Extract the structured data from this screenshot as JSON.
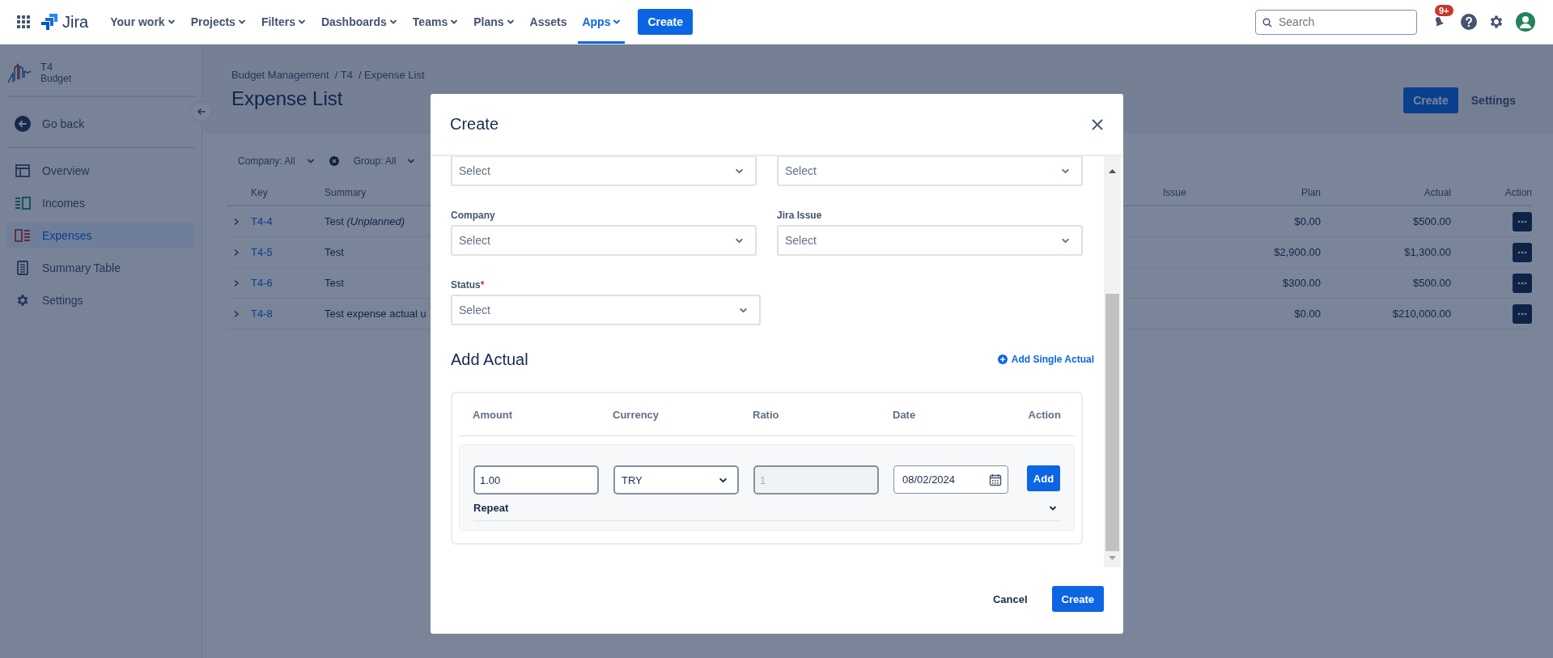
{
  "top_nav": {
    "product": "Jira",
    "items": [
      {
        "label": "Your work",
        "dropdown": true,
        "selected": false
      },
      {
        "label": "Projects",
        "dropdown": true,
        "selected": false
      },
      {
        "label": "Filters",
        "dropdown": true,
        "selected": false
      },
      {
        "label": "Dashboards",
        "dropdown": true,
        "selected": false
      },
      {
        "label": "Teams",
        "dropdown": true,
        "selected": false
      },
      {
        "label": "Plans",
        "dropdown": true,
        "selected": false
      },
      {
        "label": "Assets",
        "dropdown": false,
        "selected": false
      },
      {
        "label": "Apps",
        "dropdown": true,
        "selected": true
      }
    ],
    "create_button": "Create",
    "search": {
      "placeholder": "Search"
    },
    "notifications_badge": "9+"
  },
  "sidebar": {
    "project": {
      "name": "T4",
      "subtitle": "Budget"
    },
    "back": "Go back",
    "items": [
      {
        "label": "Overview",
        "selected": false
      },
      {
        "label": "Incomes",
        "selected": false
      },
      {
        "label": "Expenses",
        "selected": true
      },
      {
        "label": "Summary Table",
        "selected": false
      },
      {
        "label": "Settings",
        "selected": false
      }
    ]
  },
  "page": {
    "breadcrumbs": [
      "Budget Management",
      "/ T4",
      "/ Expense List"
    ],
    "title": "Expense List",
    "buttons": [
      {
        "label": "Create",
        "kind": "primary"
      },
      {
        "label": "Settings",
        "kind": "default"
      }
    ],
    "filters": [
      {
        "label": "Company: All",
        "clearable": true
      },
      {
        "label": "Group: All",
        "clearable": false
      }
    ],
    "table": {
      "columns": [
        "Key",
        "Summary",
        "Issue",
        "Plan",
        "Actual",
        "Action"
      ],
      "rows": [
        {
          "key": "T4-4",
          "summary": "Test *(Unplanned)*",
          "plan": "$0.00",
          "actual": "$500.00"
        },
        {
          "key": "T4-5",
          "summary": "Test",
          "plan": "$2,900.00",
          "actual": "$1,300.00"
        },
        {
          "key": "T4-6",
          "summary": "Test",
          "plan": "$300.00",
          "actual": "$500.00"
        },
        {
          "key": "T4-8",
          "summary": "Test expense actual u",
          "plan": "$0.00",
          "actual": "$210,000.00"
        }
      ]
    }
  },
  "modal": {
    "title": "Create",
    "top_fields": [
      {
        "placeholder": "Select"
      },
      {
        "placeholder": "Select"
      }
    ],
    "fields": [
      {
        "label": "Company",
        "placeholder": "Select"
      },
      {
        "label": "Jira Issue",
        "placeholder": "Select"
      },
      {
        "label": "Status",
        "required_mark": "*",
        "placeholder": "Select"
      }
    ],
    "actual": {
      "heading": "Add Actual",
      "add_link": "Add Single Actual",
      "columns": [
        "Amount",
        "Currency",
        "Ratio",
        "Date",
        "Action"
      ],
      "row": {
        "amount": "1.00",
        "currency": "TRY",
        "ratio": "1",
        "ratio_disabled": true,
        "date": "08/02/2024",
        "add_button": "Add",
        "repeat": "Repeat",
        "repeat_expanded": false
      }
    },
    "footer_buttons": [
      {
        "label": "Cancel",
        "kind": "subtle"
      },
      {
        "label": "Create",
        "kind": "primary"
      }
    ]
  }
}
